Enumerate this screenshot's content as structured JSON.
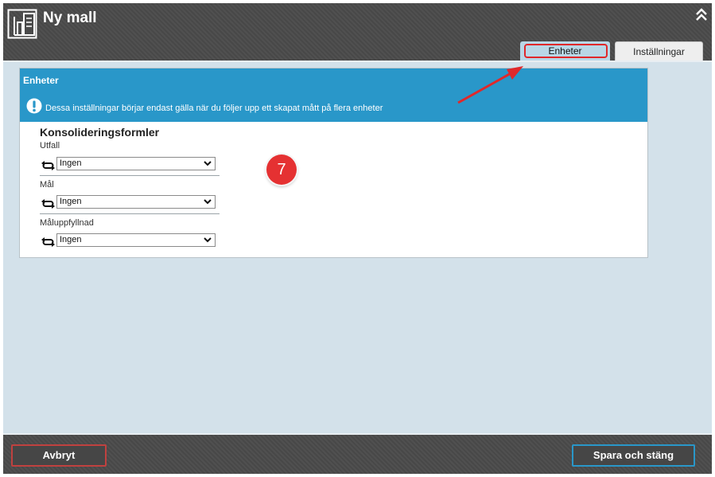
{
  "window": {
    "title": "Ny mall"
  },
  "tabs": [
    {
      "label": "Enheter",
      "active": true
    },
    {
      "label": "Inställningar",
      "active": false
    }
  ],
  "panel": {
    "title": "Enheter",
    "info_text": "Dessa inställningar börjar endast gälla när du följer upp ett skapat mått på flera enheter",
    "section_title": "Konsolideringsformler",
    "fields": [
      {
        "label": "Utfall",
        "value": "Ingen"
      },
      {
        "label": "Mål",
        "value": "Ingen"
      },
      {
        "label": "Måluppfyllnad",
        "value": "Ingen"
      }
    ]
  },
  "annotation": {
    "step": "7"
  },
  "footer": {
    "cancel_label": "Avbryt",
    "save_label": "Spara och stäng"
  },
  "icons": {
    "app": "template-icon",
    "collapse": "double-chevron-up-icon",
    "info": "exclamation-circle-icon",
    "consolidation": "link-arrows-icon",
    "dropdown": "chevron-down-icon"
  },
  "colors": {
    "header_bg": "#4a4a4a",
    "panel_head_bg": "#2997c9",
    "content_bg": "#d3e1ea",
    "highlight": "#e0282a"
  }
}
